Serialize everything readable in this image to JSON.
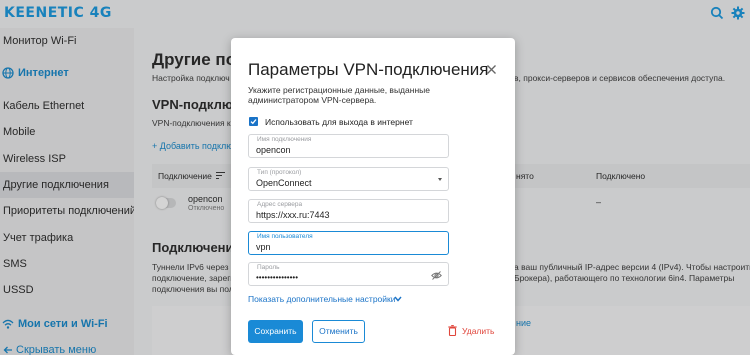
{
  "header": {
    "logo": "KEENETIC 4G",
    "icons": [
      "search-icon",
      "gear-icon"
    ]
  },
  "sidebar": {
    "items": [
      {
        "label": "Монитор Wi-Fi"
      },
      {
        "label": "Интернет",
        "section": true,
        "icon": "globe-icon"
      },
      {
        "label": "Кабель Ethernet"
      },
      {
        "label": "Mobile"
      },
      {
        "label": "Wireless ISP"
      },
      {
        "label": "Другие подключения",
        "active": true
      },
      {
        "label": "Приоритеты подключений"
      },
      {
        "label": "Учет трафика"
      },
      {
        "label": "SMS"
      },
      {
        "label": "USSD"
      },
      {
        "label": "Мои сети и Wi-Fi",
        "section": true,
        "icon": "wifi-icon"
      },
      {
        "label": "Скрывать меню",
        "icon": "arrow-left-icon"
      }
    ]
  },
  "page": {
    "title": "Другие подк",
    "description_left": "Настройка подключ",
    "description_right": "в, прокси-серверов и сервисов обеспечения доступа.",
    "vpn_title": "VPN-подключ",
    "vpn_desc": "VPN-подключения к",
    "add_link": "+ Добавить подклю",
    "table": {
      "col_connection": "Подключение",
      "col_right1": "нято",
      "col_right2": "Подключено",
      "rows": [
        {
          "name": "opencon",
          "status": "Отключено",
          "connected": "–"
        }
      ]
    },
    "ipv6_title": "Подключения",
    "ipv6_text_left": [
      "Туннели IPv6 через IP",
      "подключение, зареги",
      "подключения вы пол"
    ],
    "ipv6_text_right": [
      "а ваш публичный IP-адрес версии 4 (IPv4). Чтобы настроить",
      "Брокера), работающего по технологии 6in4. Параметры"
    ],
    "bottom_link": "ние"
  },
  "modal": {
    "title": "Параметры VPN-подключения",
    "description": "Укажите регистрационные данные, выданные администратором VPN-сервера.",
    "use_for_internet": {
      "label": "Использовать для выхода в интернет",
      "checked": true
    },
    "fields": {
      "name": {
        "label": "Имя подключения",
        "value": "opencon"
      },
      "protocol": {
        "label": "Тип (протокол)",
        "value": "OpenConnect"
      },
      "server": {
        "label": "Адрес сервера",
        "value": "https://xxx.ru:7443"
      },
      "username": {
        "label": "Имя пользователя",
        "value": "vpn"
      },
      "password": {
        "label": "Пароль",
        "value": "•••••••••••••••"
      }
    },
    "more_settings": "Показать дополнительные настройки",
    "buttons": {
      "save": "Сохранить",
      "cancel": "Отменить",
      "delete": "Удалить"
    },
    "accent": "#1a8ad6",
    "danger": "#e0463c"
  }
}
